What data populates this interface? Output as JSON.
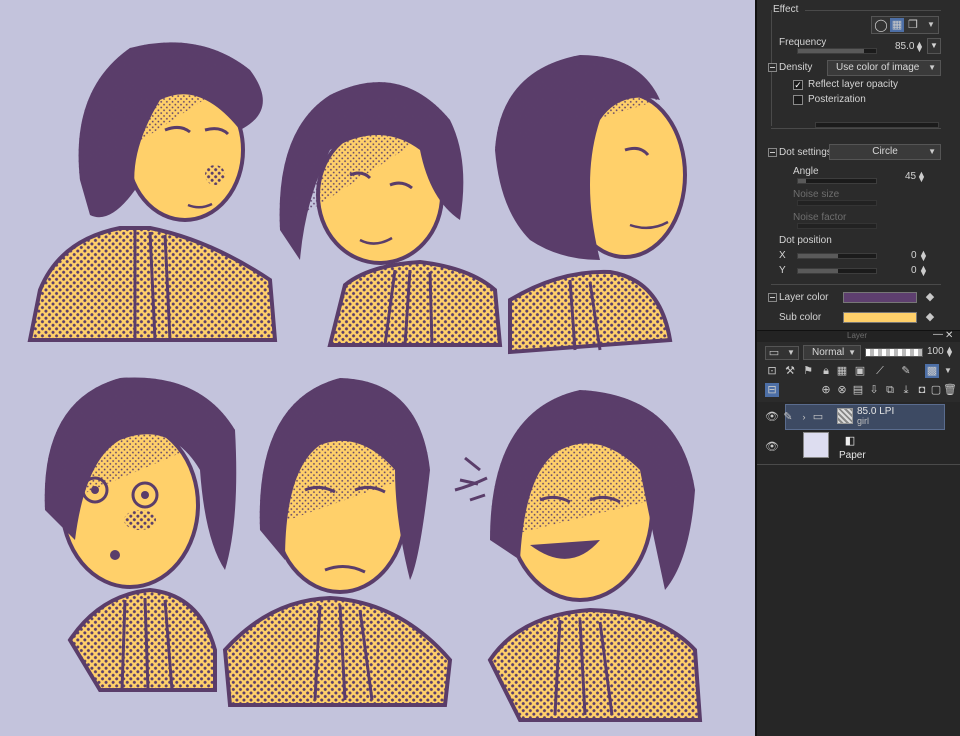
{
  "effect": {
    "title": "Effect",
    "frequency_label": "Frequency",
    "frequency_value": "85.0",
    "frequency_fraction": 0.85
  },
  "density": {
    "label": "Density",
    "selected": "Use color of image",
    "reflect_opacity_label": "Reflect layer opacity",
    "reflect_opacity_checked": true,
    "posterization_label": "Posterization",
    "posterization_checked": false
  },
  "dot_settings": {
    "label": "Dot settings",
    "selected": "Circle",
    "angle_label": "Angle",
    "angle_value": "45",
    "noise_size_label": "Noise size",
    "noise_factor_label": "Noise factor",
    "dot_position_label": "Dot position",
    "x_label": "X",
    "x_value": "0",
    "y_label": "Y",
    "y_value": "0"
  },
  "colors": {
    "layer_color_label": "Layer color",
    "layer_color": "#5e3f6f",
    "sub_color_label": "Sub color",
    "sub_color": "#ffd06a"
  },
  "layer_panel": {
    "title": "Layer",
    "blend_mode": "Normal",
    "opacity": "100",
    "layers": [
      {
        "name": "85.0 LPI",
        "sub": "girl",
        "selected": true
      },
      {
        "name": "Paper",
        "sub": "",
        "selected": false
      }
    ]
  },
  "canvas": {
    "background": "#c3c3dc",
    "skin": "#ffd06a",
    "ink": "#5a3d6a"
  }
}
